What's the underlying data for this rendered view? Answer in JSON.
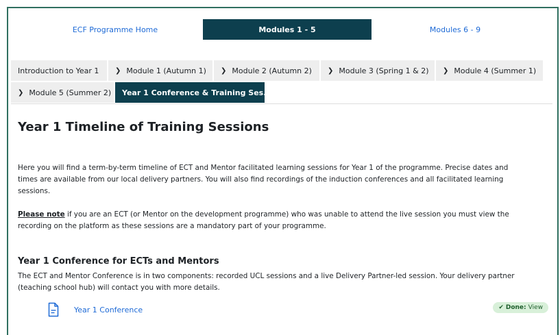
{
  "topnav": {
    "items": [
      "ECF Programme Home",
      "Modules 1 - 5",
      "Modules 6 - 9"
    ],
    "active_index": 1
  },
  "tabs": {
    "row1": [
      "Introduction to Year 1",
      "Module 1 (Autumn 1)",
      "Module 2 (Autumn 2)",
      "Module 3 (Spring 1 & 2)",
      "Module 4 (Summer 1)"
    ],
    "row2": [
      "Module 5 (Summer 2)",
      "Year 1 Conference & Training Ses..."
    ]
  },
  "content": {
    "title": "Year 1 Timeline of Training Sessions",
    "intro": "Here you will find a term-by-term timeline of ECT and Mentor facilitated learning sessions for Year 1 of the programme. Precise dates and times are available from our local delivery partners. You will also find recordings of the induction conferences and all facilitated learning sessions.",
    "note_label": "Please note",
    "note_text": " if you are an ECT (or Mentor on the development programme) who was unable to attend the live session you must view the recording on the platform as these sessions are a mandatory part of your programme.",
    "section_title": "Year 1 Conference for ECTs and Mentors",
    "section_text": "The ECT and Mentor Conference is in two components: recorded UCL sessions and a live Delivery Partner-led session. Your delivery partner (teaching school hub) will contact you with more details."
  },
  "activity": {
    "label": "Year 1 Conference",
    "badge_check": "✔",
    "badge_done": "Done:",
    "badge_view": "View"
  },
  "colors": {
    "accent": "#0d3f4e",
    "link": "#1e6ad6",
    "frame": "#2f6f5f",
    "done_bg": "#d8f0d9"
  }
}
